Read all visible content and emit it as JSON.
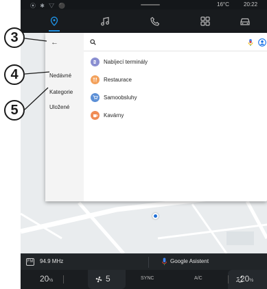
{
  "callouts": {
    "c3": "3",
    "c4": "4",
    "c5": "5"
  },
  "status": {
    "signal": "⦿ ✱ ▽ ⚫",
    "temperature": "16°C",
    "time": "20:22"
  },
  "nav": {
    "tabs": [
      "navigation",
      "music",
      "phone",
      "apps",
      "vehicle"
    ],
    "active_color": "#1f8fe0"
  },
  "side_menu": {
    "back_label": "←",
    "items": [
      "Nedávné",
      "Kategorie",
      "Uložené"
    ]
  },
  "search": {
    "value": "",
    "placeholder": ""
  },
  "categories": [
    {
      "label": "Nabíjecí terminály",
      "color": "#8a8fd1",
      "icon": "charging-station-icon"
    },
    {
      "label": "Restaurace",
      "color": "#f3a15b",
      "icon": "restaurant-icon"
    },
    {
      "label": "Samoobsluhy",
      "color": "#5b8fd6",
      "icon": "shopping-cart-icon"
    },
    {
      "label": "Kavárny",
      "color": "#f08c54",
      "icon": "coffee-icon"
    }
  ],
  "media": {
    "frequency": "94.9 MHz",
    "assistant": "Google Asistent"
  },
  "climate": {
    "left_temp": "20",
    "left_unit": "½",
    "fan_speed": "5",
    "sync_label": "SYNC",
    "ac_label": "A/C",
    "right_temp": "20",
    "right_unit": "½"
  }
}
